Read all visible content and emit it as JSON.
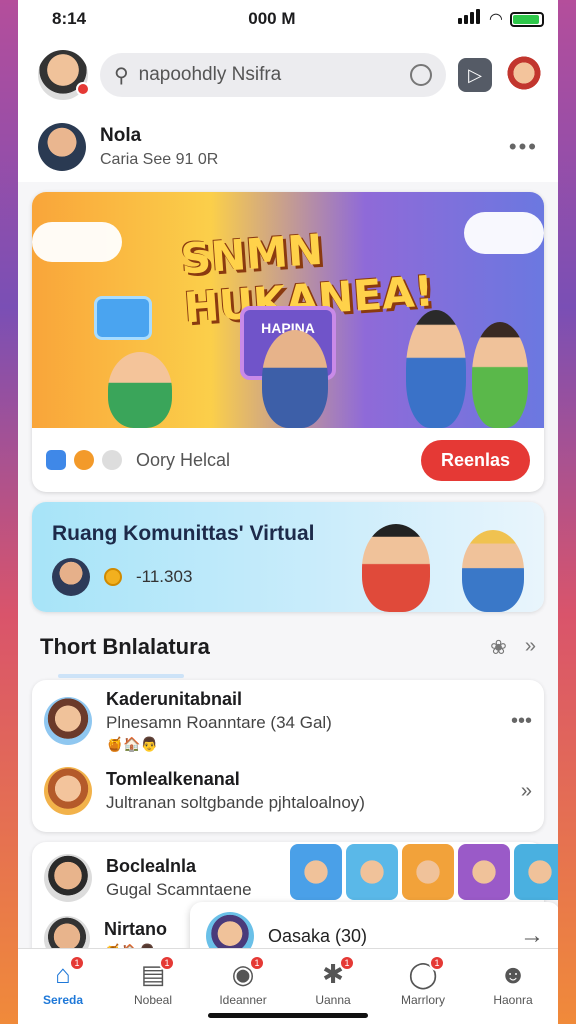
{
  "status": {
    "time_left": "8:14",
    "time_center": "000 M"
  },
  "search": {
    "placeholder": "napoohdly Nsifra"
  },
  "profile": {
    "name": "Nola",
    "subtitle": "Caria See 91 0R"
  },
  "hero": {
    "title": "SNMN HUKANEA!",
    "board_label": "HAPINA",
    "footer_text": "Oory Helcal",
    "action_label": "Reenlas"
  },
  "community": {
    "title": "Ruang Komunittas' Virtual",
    "count": "-11.303"
  },
  "section": {
    "title": "Thort Bnlalatura"
  },
  "list": [
    {
      "title": "Kaderunitabnail",
      "subtitle": "Plnesamn Roanntare (34 Gal)",
      "emoji": "🍯🏠👨"
    },
    {
      "title": "Tomlealkenanal",
      "subtitle": "Jultranan soltgbande pjhtaloalnoy)",
      "emoji": ""
    }
  ],
  "card3": {
    "item1": {
      "title": "Boclealnla",
      "subtitle": "Gugal Scamntaene"
    },
    "item2": {
      "title": "Nirtano",
      "emoji": "🍯🏠👨"
    },
    "popup": {
      "text": "Oasaka (30)"
    }
  },
  "nav": [
    {
      "label": "Sereda",
      "icon": "home-icon",
      "badge": "1"
    },
    {
      "label": "Nobeal",
      "icon": "library-icon",
      "badge": "1"
    },
    {
      "label": "Ideanner",
      "icon": "camera-icon",
      "badge": "1"
    },
    {
      "label": "Uanna",
      "icon": "explore-icon",
      "badge": "1"
    },
    {
      "label": "Marrlory",
      "icon": "chat-icon",
      "badge": "1"
    },
    {
      "label": "Haonra",
      "icon": "profile-icon",
      "badge": ""
    }
  ],
  "colors": {
    "accent": "#e53935",
    "brand_blue": "#1e78d8"
  }
}
